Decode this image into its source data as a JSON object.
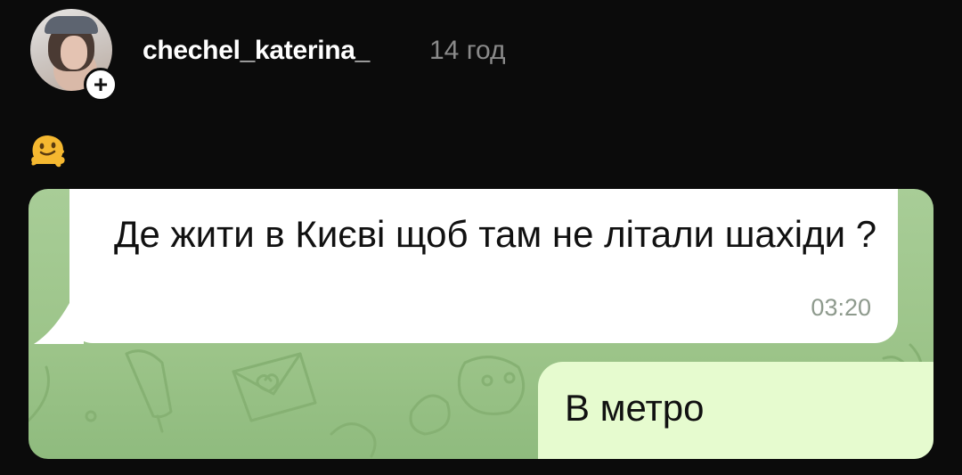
{
  "header": {
    "username": "chechel_katerina_",
    "time_ago": "14 год",
    "add_badge": "+",
    "avatar_icon": "profile-photo",
    "add_icon": "plus-icon"
  },
  "caption": {
    "emoji_icon": "melting-face-emoji"
  },
  "chat": {
    "incoming": {
      "text": "Де жити в Києві щоб там не літали шахіди ?",
      "time": "03:20"
    },
    "outgoing": {
      "text": "В метро"
    },
    "colors": {
      "background": "#9cc489",
      "incoming_bubble": "#ffffff",
      "outgoing_bubble": "#e6fbcf"
    }
  }
}
